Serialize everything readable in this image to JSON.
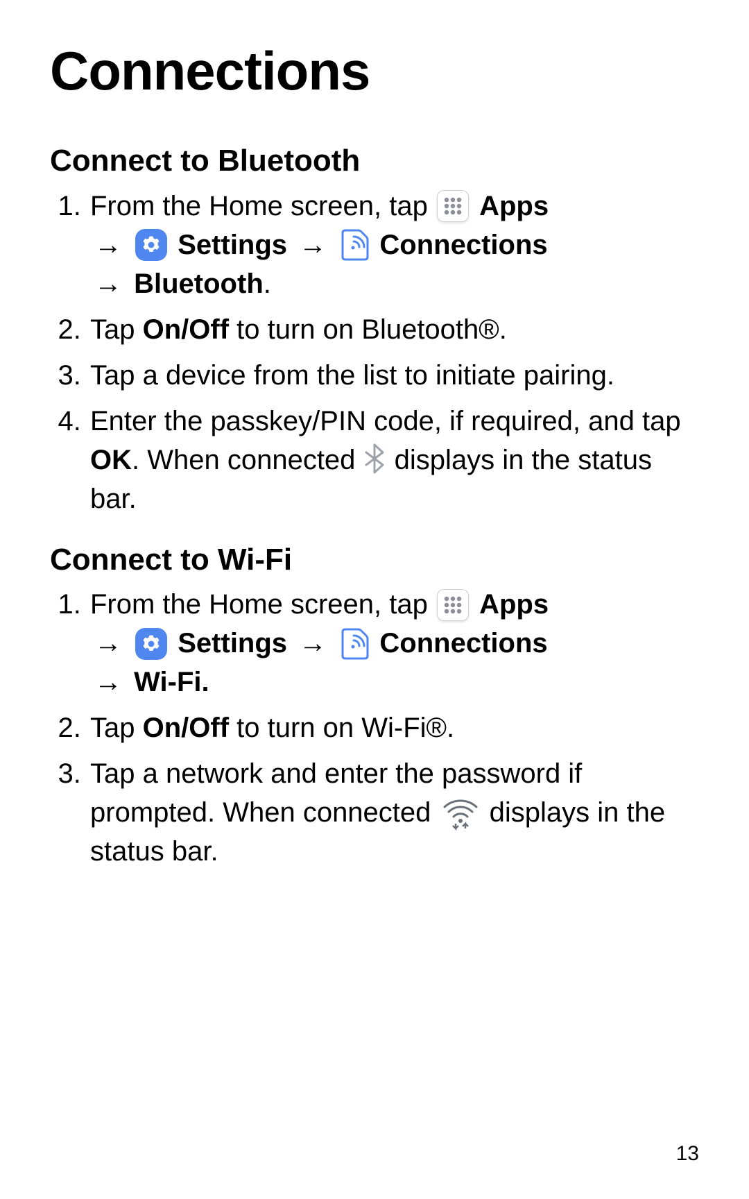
{
  "page_title": "Connections",
  "page_number": "13",
  "arrow": "→",
  "labels": {
    "apps": "Apps",
    "settings": "Settings",
    "connections": "Connections",
    "bluetooth": "Bluetooth",
    "wifi": "Wi-Fi.",
    "on_off": "On/Off",
    "ok": "OK"
  },
  "bluetooth_section": {
    "heading": "Connect to Bluetooth",
    "step1_a": "From the Home screen, tap ",
    "step2_a": "Tap ",
    "step2_b": " to turn on Bluetooth®.",
    "step3": "Tap a device from the list to initiate pairing.",
    "step4_a": "Enter the passkey/PIN code, if required, and tap ",
    "step4_b": ". When connected ",
    "step4_c": " displays in the status bar."
  },
  "wifi_section": {
    "heading": "Connect to Wi-Fi",
    "step1_a": "From the Home screen, tap ",
    "step2_a": "Tap ",
    "step2_b": " to turn on Wi-Fi®.",
    "step3_a": "Tap a network and enter the password if prompted. When connected ",
    "step3_b": " displays in the status bar."
  }
}
